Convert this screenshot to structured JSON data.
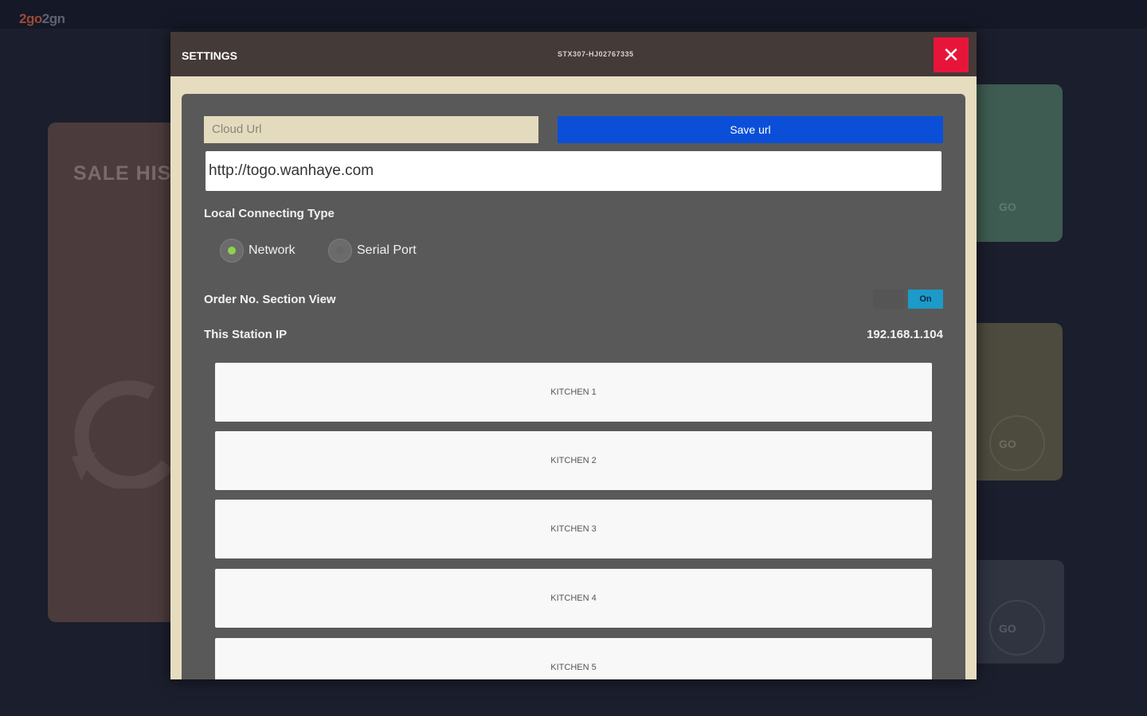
{
  "app": {
    "logo_part1": "2go",
    "logo_part2": "2gn"
  },
  "background": {
    "sale_card_title": "SALE HIST",
    "go_labels": [
      "GO",
      "GO",
      "GO"
    ]
  },
  "modal": {
    "title": "SETTINGS",
    "station_id": "STX307-HJ02767335",
    "close_icon": "close-icon",
    "cloud_url_label": "Cloud Url",
    "save_url_label": "Save url",
    "cloud_url_value": "http://togo.wanhaye.com",
    "local_connecting_type_label": "Local Connecting Type",
    "connection_options": [
      {
        "label": "Network",
        "selected": true
      },
      {
        "label": "Serial Port",
        "selected": false
      }
    ],
    "order_section_view_label": "Order No. Section View",
    "order_section_toggle": "On",
    "station_ip_label": "This Station IP",
    "station_ip_value": "192.168.1.104",
    "kitchens": [
      "KITCHEN 1",
      "KITCHEN 2",
      "KITCHEN 3",
      "KITCHEN 4",
      "KITCHEN 5"
    ]
  },
  "colors": {
    "background": "#1b1e2c",
    "modal_header": "#443a38",
    "modal_body": "#e6dcc0",
    "panel": "#595959",
    "save_button": "#0b4fd9",
    "close_button": "#e8153a",
    "toggle_on": "#1c9ac9",
    "radio_selected": "#8fd14f"
  }
}
